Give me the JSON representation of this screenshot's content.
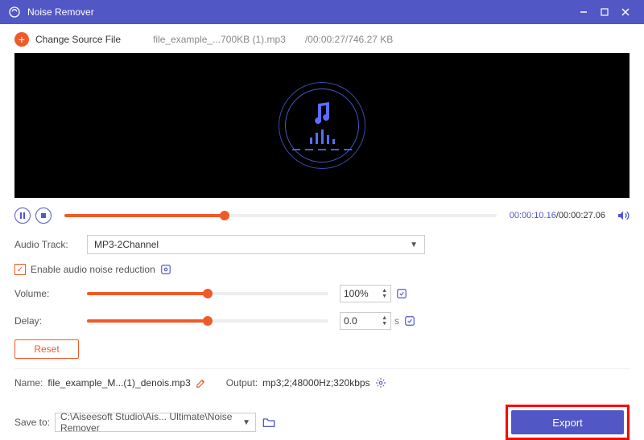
{
  "window": {
    "title": "Noise Remover"
  },
  "source": {
    "change_label": "Change Source File",
    "filename": "file_example_...700KB (1).mp3",
    "duration_size": "/00:00:27/746.27 KB"
  },
  "player": {
    "current_time": "00:00:10.16",
    "total_time": "/00:00:27.06",
    "progress_pct": 37
  },
  "audio_track": {
    "label": "Audio Track:",
    "value": "MP3-2Channel"
  },
  "noise_reduction": {
    "label": "Enable audio noise reduction",
    "checked": true
  },
  "volume": {
    "label": "Volume:",
    "value": "100%",
    "pct": 50
  },
  "delay": {
    "label": "Delay:",
    "value": "0.0",
    "unit": "s",
    "pct": 50
  },
  "reset": {
    "label": "Reset"
  },
  "output": {
    "name_label": "Name:",
    "name_value": "file_example_M...(1)_denois.mp3",
    "output_label": "Output:",
    "output_value": "mp3;2;48000Hz;320kbps",
    "saveto_label": "Save to:",
    "saveto_value": "C:\\Aiseesoft Studio\\Ais... Ultimate\\Noise Remover"
  },
  "export": {
    "label": "Export"
  }
}
